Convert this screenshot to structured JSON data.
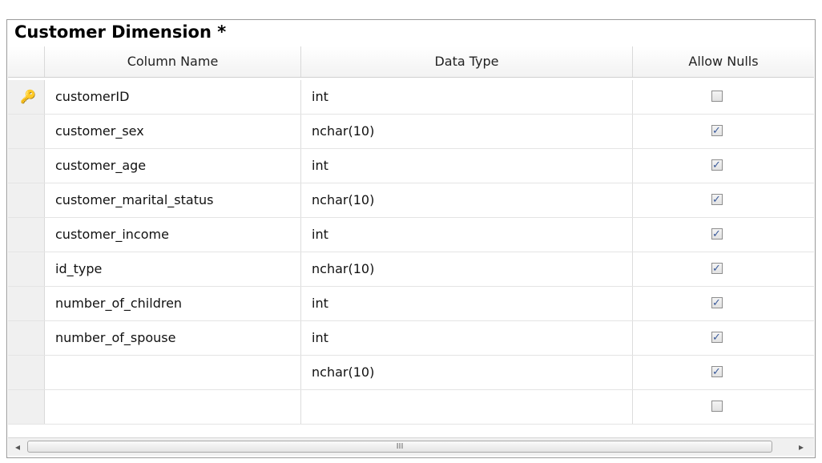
{
  "window_title": "Customer Dimension *",
  "columns": [
    "Column Name",
    "Data Type",
    "Allow Nulls"
  ],
  "rows": [
    {
      "name": "customerID",
      "type": "int",
      "allow_nulls": false,
      "primary_key": true
    },
    {
      "name": "customer_sex",
      "type": "nchar(10)",
      "allow_nulls": true
    },
    {
      "name": "customer_age",
      "type": "int",
      "allow_nulls": true
    },
    {
      "name": "customer_marital_status",
      "type": "nchar(10)",
      "allow_nulls": true
    },
    {
      "name": "customer_income",
      "type": "int",
      "allow_nulls": true
    },
    {
      "name": "id_type",
      "type": "nchar(10)",
      "allow_nulls": true
    },
    {
      "name": "number_of_children",
      "type": "int",
      "allow_nulls": true
    },
    {
      "name": "number_of_spouse",
      "type": "int",
      "allow_nulls": true
    },
    {
      "name": "",
      "type": "nchar(10)",
      "allow_nulls": true
    },
    {
      "name": "",
      "type": "",
      "allow_nulls": false
    }
  ],
  "scrollbar": {
    "thumb_grip": "III"
  },
  "icons": {
    "key": "primary-key-icon",
    "left": "scroll-left-arrow-icon",
    "right": "scroll-right-arrow-icon"
  }
}
